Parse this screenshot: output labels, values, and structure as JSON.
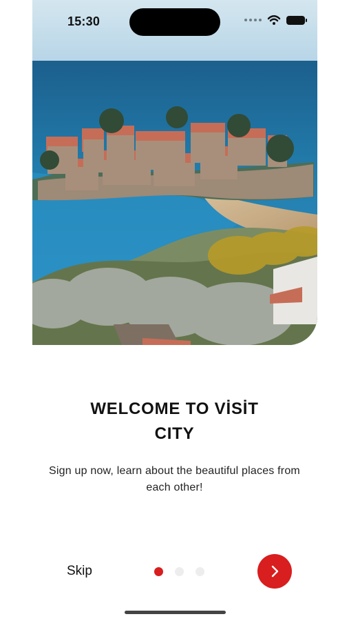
{
  "status_bar": {
    "time": "15:30",
    "icons": [
      "signal-dots-icon",
      "wifi-icon",
      "battery-icon"
    ]
  },
  "hero": {
    "image_alt": "Coastal island town with turquoise sea",
    "accent": "#d81e1e"
  },
  "onboarding": {
    "title": "WELCOME TO VİSİT CITY",
    "description": "Sign up now, learn about the beautiful places from each other!",
    "skip_label": "Skip",
    "page_count": 3,
    "current_page": 1,
    "next_icon": "chevron-right-icon"
  },
  "colors": {
    "accent": "#d81e1e",
    "inactive_dot": "#ededed",
    "text": "#111111"
  }
}
